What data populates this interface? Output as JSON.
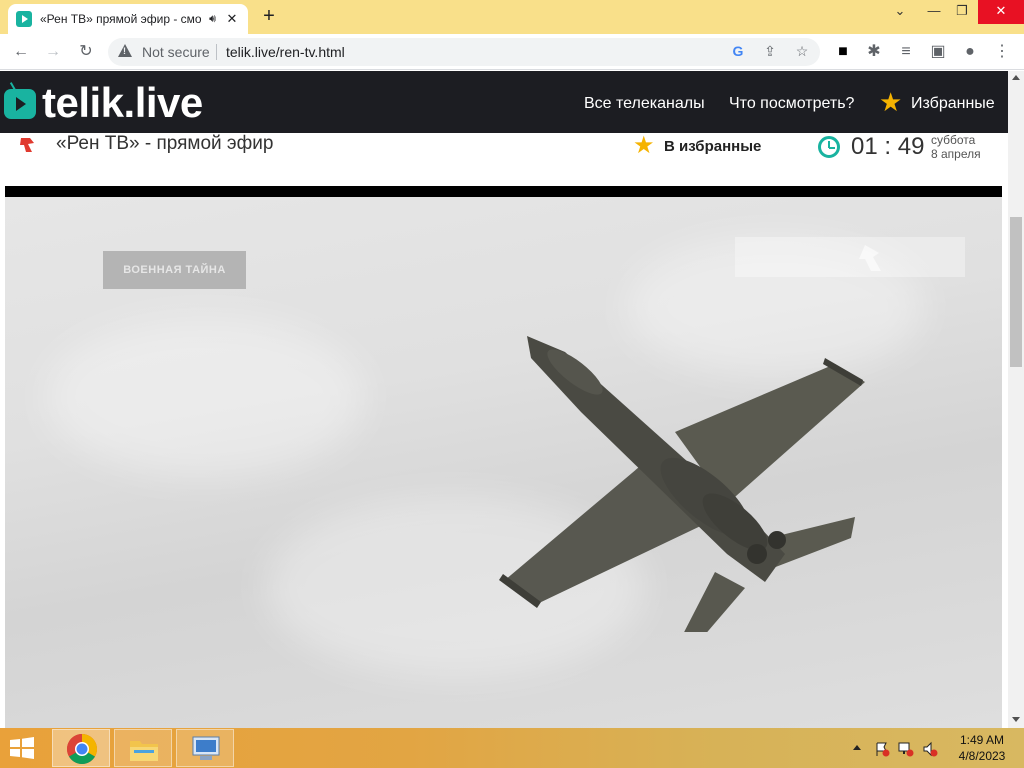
{
  "browser": {
    "tab_title": "«Рен ТВ» прямой эфир - смотреть онлайн",
    "tab_audio_icon": "speaker-icon",
    "tab_close": "✕",
    "new_tab": "+",
    "security_label": "Not secure",
    "url": "telik.live/ren-tv.html"
  },
  "site": {
    "logo": "telik.live",
    "nav": {
      "all_channels": "Все телеканалы",
      "what_to_watch": "Что посмотреть?",
      "favorites": "Избранные"
    },
    "accent_color": "#19b3a0",
    "star_color": "#f5b301"
  },
  "channel": {
    "title": "«Рен ТВ» - прямой эфир",
    "add_favorite": "В избранные",
    "time_hours": "01",
    "time_minutes": "49",
    "weekday": "суббота",
    "date": "8 апреля"
  },
  "video": {
    "show_badge": "ВОЕННАЯ ТАЙНА"
  },
  "taskbar": {
    "time": "1:49 AM",
    "date": "4/8/2023"
  }
}
